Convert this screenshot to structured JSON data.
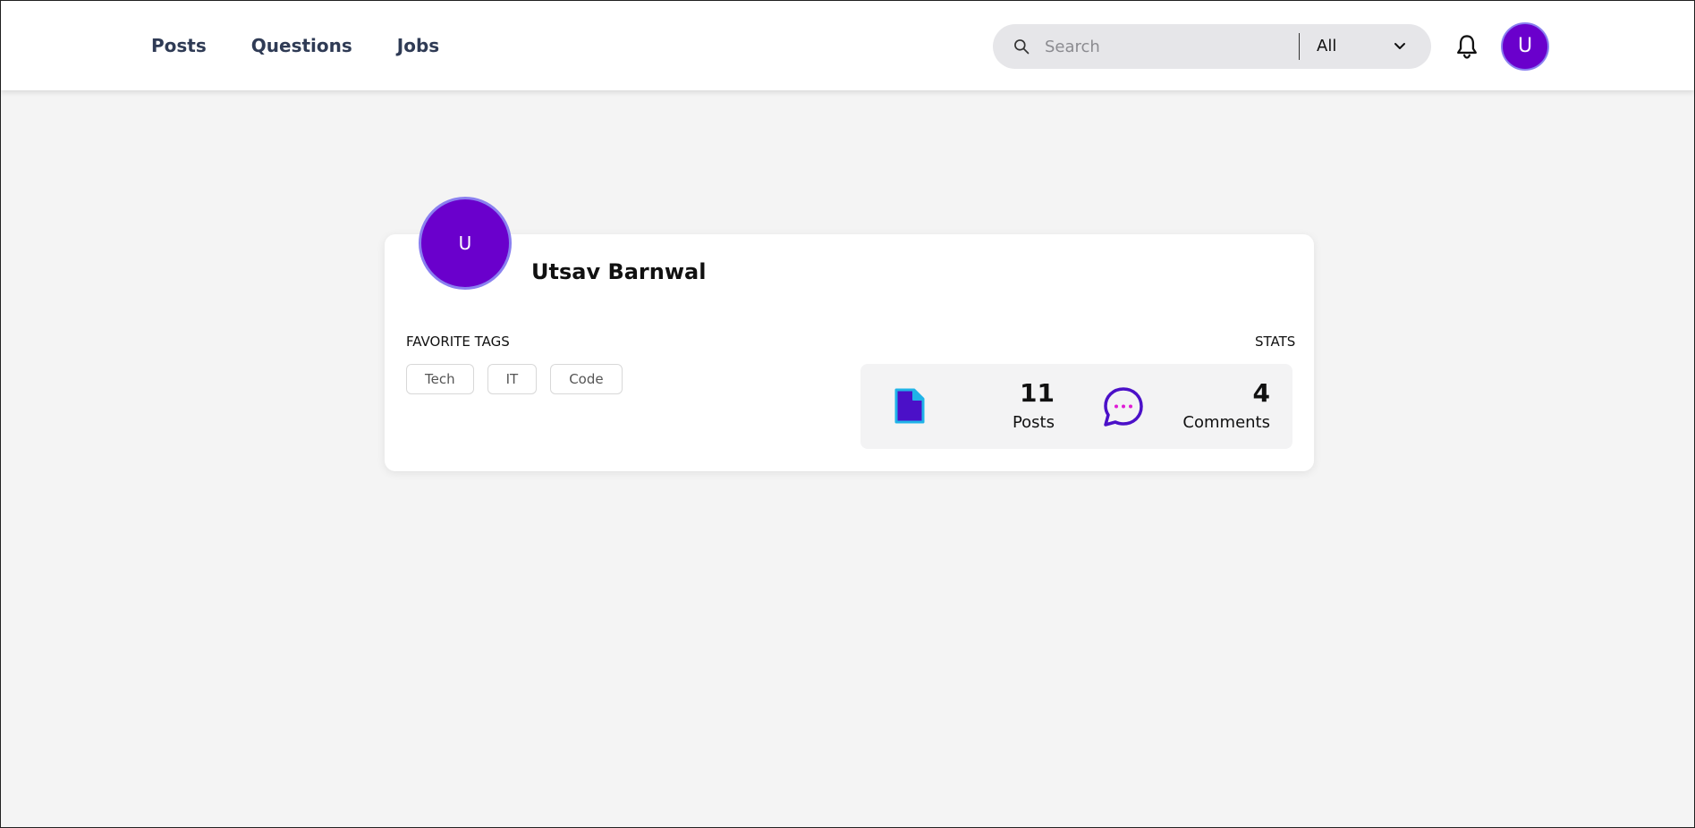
{
  "nav": {
    "items": [
      {
        "label": "Posts"
      },
      {
        "label": "Questions"
      },
      {
        "label": "Jobs"
      }
    ]
  },
  "search": {
    "placeholder": "Search",
    "filter": "All"
  },
  "user": {
    "initial": "U",
    "name": "Utsav Barnwal"
  },
  "profile": {
    "favorite_tags_label": "FAVORITE TAGS",
    "stats_label": "STATS",
    "tags": [
      {
        "label": "Tech"
      },
      {
        "label": "IT"
      },
      {
        "label": "Code"
      }
    ],
    "stats": {
      "posts": {
        "count": "11",
        "label": "Posts"
      },
      "comments": {
        "count": "4",
        "label": "Comments"
      }
    }
  },
  "colors": {
    "accent": "#6a00cc",
    "doc_icon_fill": "#4b10c8",
    "doc_icon_stroke": "#1fb3e8",
    "chat_dots": "#e01bd6"
  },
  "icons": {
    "search": "search-icon",
    "chevron": "chevron-down-icon",
    "bell": "bell-icon",
    "posts": "document-icon",
    "comments": "chat-bubble-icon"
  }
}
